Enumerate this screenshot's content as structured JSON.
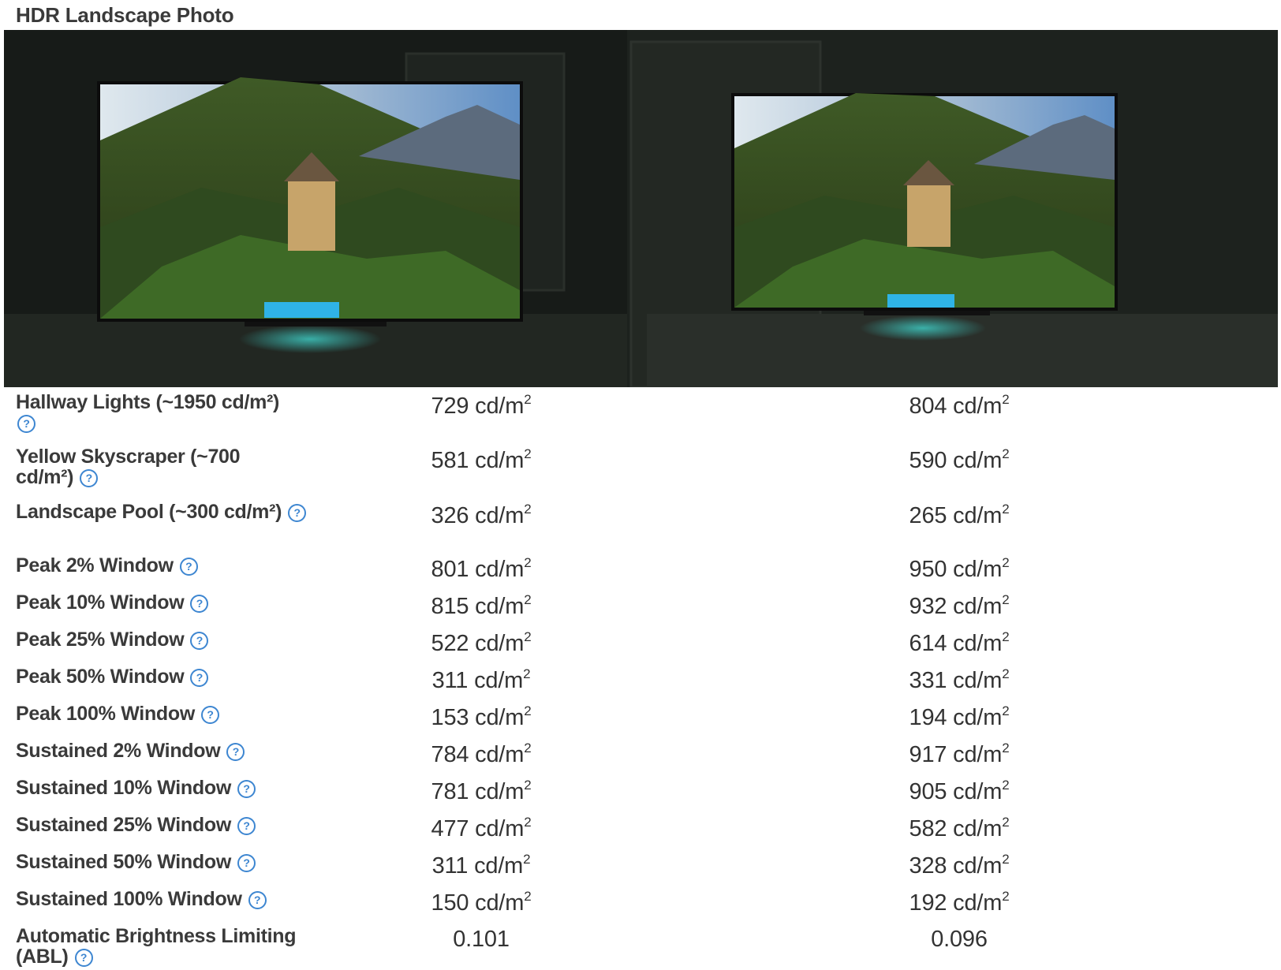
{
  "section_title": "HDR Landscape Photo",
  "photo": {
    "icon": "tv-comparison-photo"
  },
  "help_icon": "?",
  "unit": "cd/m",
  "unit_sup": "2",
  "rows": [
    {
      "label": "Hallway Lights (~1950 cd/m²)",
      "v1": "729",
      "v2": "804",
      "unit": true
    },
    {
      "label": "Yellow Skyscraper (~700 cd/m²)",
      "v1": "581",
      "v2": "590",
      "unit": true
    },
    {
      "label": "Landscape Pool (~300 cd/m²)",
      "v1": "326",
      "v2": "265",
      "unit": true
    },
    {
      "label": "Peak 2% Window",
      "v1": "801",
      "v2": "950",
      "unit": true
    },
    {
      "label": "Peak 10% Window",
      "v1": "815",
      "v2": "932",
      "unit": true
    },
    {
      "label": "Peak 25% Window",
      "v1": "522",
      "v2": "614",
      "unit": true
    },
    {
      "label": "Peak 50% Window",
      "v1": "311",
      "v2": "331",
      "unit": true
    },
    {
      "label": "Peak 100% Window",
      "v1": "153",
      "v2": "194",
      "unit": true
    },
    {
      "label": "Sustained 2% Window",
      "v1": "784",
      "v2": "917",
      "unit": true
    },
    {
      "label": "Sustained 10% Window",
      "v1": "781",
      "v2": "905",
      "unit": true
    },
    {
      "label": "Sustained 25% Window",
      "v1": "477",
      "v2": "582",
      "unit": true
    },
    {
      "label": "Sustained 50% Window",
      "v1": "311",
      "v2": "328",
      "unit": true
    },
    {
      "label": "Sustained 100% Window",
      "v1": "150",
      "v2": "192",
      "unit": true
    },
    {
      "label": "Automatic Brightness Limiting (ABL)",
      "v1": "0.101",
      "v2": "0.096",
      "unit": false
    }
  ]
}
